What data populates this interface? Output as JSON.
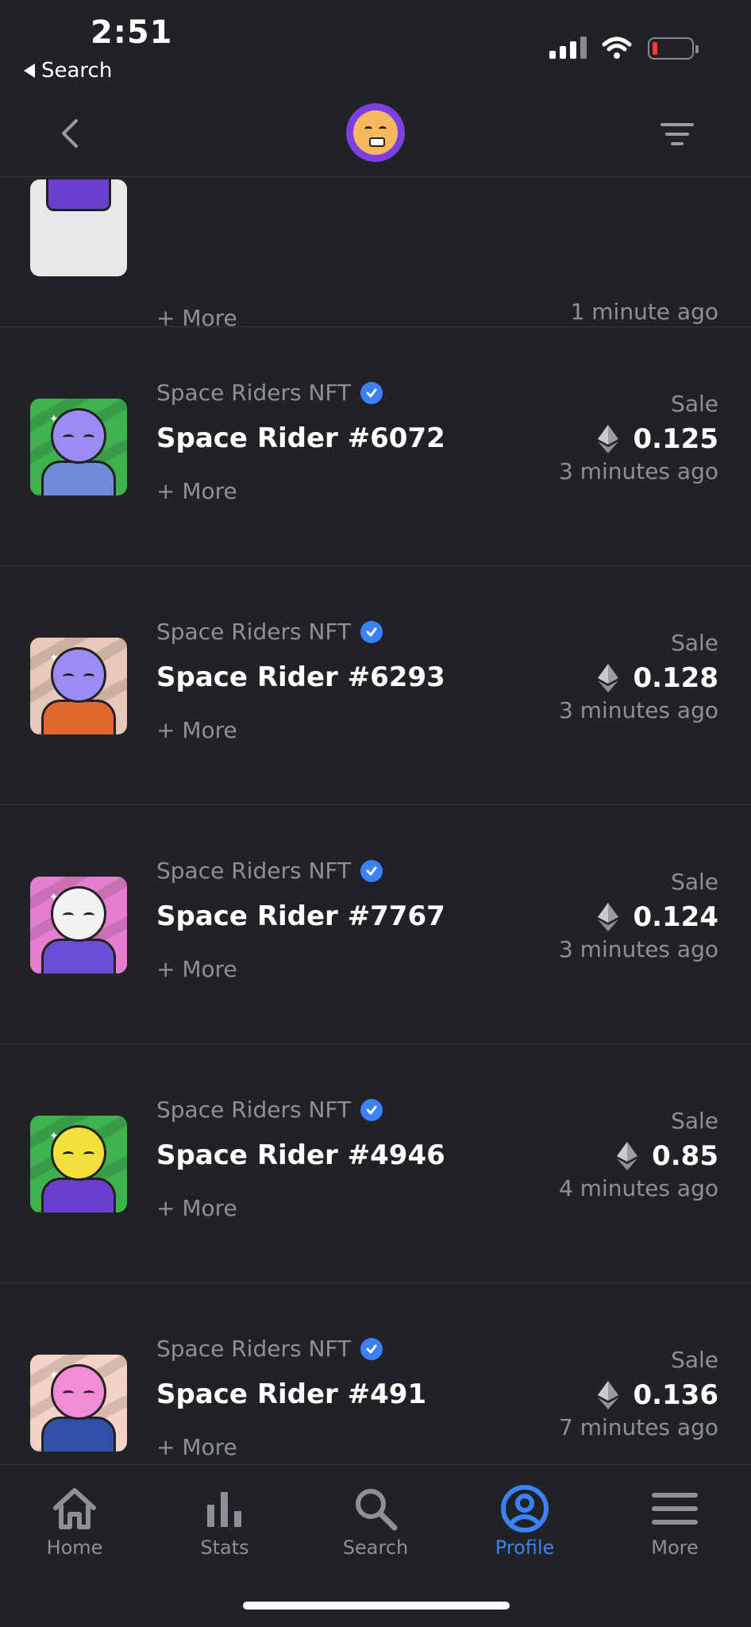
{
  "status_bar": {
    "time": "2:51",
    "back_label": "Search"
  },
  "nav": {
    "avatar_icon": "collection-avatar-icon",
    "back_icon": "chevron-left-icon",
    "filter_icon": "filter-icon"
  },
  "partial_row": {
    "more": "+ More",
    "time_ago": "1 minute ago"
  },
  "items": [
    {
      "collection": "Space Riders NFT",
      "name": "Space Rider #6072",
      "more": "+ More",
      "type": "Sale",
      "price": "0.125",
      "time_ago": "3 minutes ago",
      "bg": "#3fb24f",
      "head": "#9a8cf2",
      "suit": "#6f8ad6"
    },
    {
      "collection": "Space Riders NFT",
      "name": "Space Rider #6293",
      "more": "+ More",
      "type": "Sale",
      "price": "0.128",
      "time_ago": "3 minutes ago",
      "bg": "#e8c8b8",
      "head": "#9a8cf2",
      "suit": "#e2672e"
    },
    {
      "collection": "Space Riders NFT",
      "name": "Space Rider #7767",
      "more": "+ More",
      "type": "Sale",
      "price": "0.124",
      "time_ago": "3 minutes ago",
      "bg": "#e47fd0",
      "head": "#f2f2f2",
      "suit": "#6a4fd6"
    },
    {
      "collection": "Space Riders NFT",
      "name": "Space Rider #4946",
      "more": "+ More",
      "type": "Sale",
      "price": "0.85",
      "time_ago": "4 minutes ago",
      "bg": "#3fb24f",
      "head": "#f3e03b",
      "suit": "#6a3fd0"
    },
    {
      "collection": "Space Riders NFT",
      "name": "Space Rider #491",
      "more": "+ More",
      "type": "Sale",
      "price": "0.136",
      "time_ago": "7 minutes ago",
      "bg": "#f3d3c8",
      "head": "#f38bd6",
      "suit": "#2f4fa8"
    }
  ],
  "tabs": [
    {
      "label": "Home",
      "icon": "home-icon"
    },
    {
      "label": "Stats",
      "icon": "stats-icon"
    },
    {
      "label": "Search",
      "icon": "search-icon"
    },
    {
      "label": "Profile",
      "icon": "profile-icon",
      "active": true
    },
    {
      "label": "More",
      "icon": "menu-icon"
    }
  ],
  "colors": {
    "background": "#212226",
    "accent": "#3b82f6",
    "muted_text": "#8e9097",
    "verified": "#3b82f6"
  }
}
